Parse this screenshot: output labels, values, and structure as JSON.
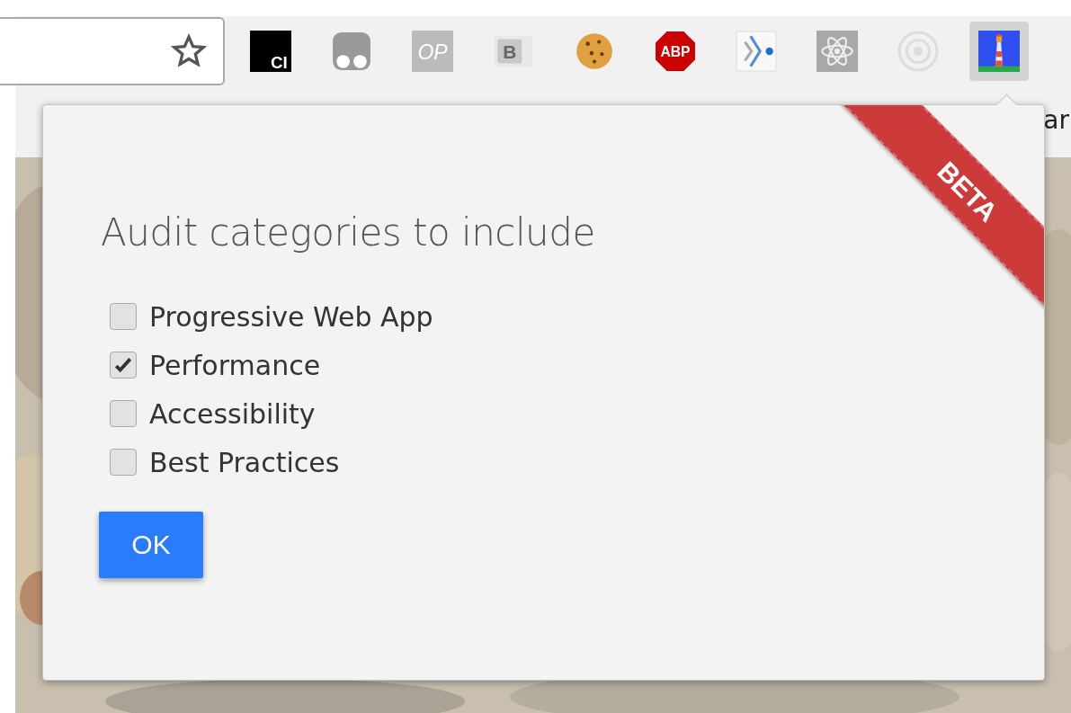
{
  "address_bar": {
    "bookmarked": false
  },
  "extensions": [
    {
      "kind": "ci",
      "label": "CI",
      "selected": false
    },
    {
      "kind": "glasses",
      "selected": false
    },
    {
      "kind": "op",
      "label": "OP",
      "selected": false
    },
    {
      "kind": "b",
      "label": "B",
      "selected": false
    },
    {
      "kind": "cookie",
      "selected": false
    },
    {
      "kind": "abp",
      "label": "ABP",
      "selected": false
    },
    {
      "kind": "arrow",
      "selected": false
    },
    {
      "kind": "atom",
      "selected": false
    },
    {
      "kind": "target",
      "selected": false
    },
    {
      "kind": "lighthouse",
      "selected": true
    }
  ],
  "bookmarks_bar": {
    "text": "ar"
  },
  "popup": {
    "ribbon": "BETA",
    "heading": "Audit categories to include",
    "categories": [
      {
        "label": "Progressive Web App",
        "checked": false
      },
      {
        "label": "Performance",
        "checked": true
      },
      {
        "label": "Accessibility",
        "checked": false
      },
      {
        "label": "Best Practices",
        "checked": false
      }
    ],
    "button": "OK"
  }
}
